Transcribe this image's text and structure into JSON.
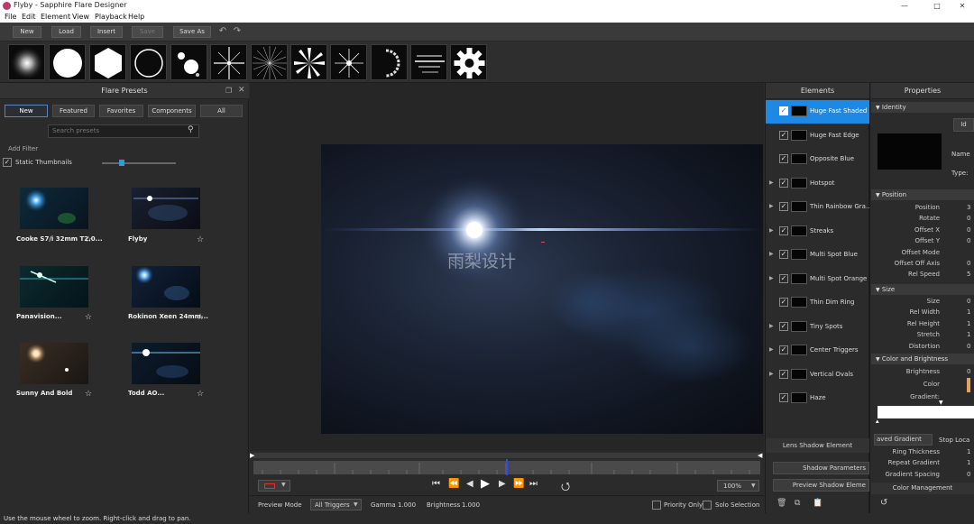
{
  "window": {
    "title": "Flyby - Sapphire Flare Designer"
  },
  "menu": [
    "File",
    "Edit",
    "Element",
    "View",
    "Playback",
    "Help"
  ],
  "toolbar": {
    "new": "New",
    "load": "Load",
    "insert": "Insert",
    "save": "Save",
    "save_as": "Save As"
  },
  "element_palette": [
    "glow",
    "circle",
    "hexagon",
    "ring",
    "spots",
    "star-4",
    "starburst",
    "rays",
    "sparkle",
    "arc",
    "streaks",
    "gear"
  ],
  "presets": {
    "title": "Flare Presets",
    "tabs": [
      "New",
      "Featured",
      "Favorites",
      "Components",
      "All"
    ],
    "search_placeholder": "Search presets",
    "add_filter": "Add Filter",
    "static_thumbnails": "Static Thumbnails",
    "items": [
      {
        "name": "Cooke S7/i 32mm T2.0..."
      },
      {
        "name": "Flyby"
      },
      {
        "name": "Panavision..."
      },
      {
        "name": "Rokinon Xeen 24mm..."
      },
      {
        "name": "Sunny And Bold"
      },
      {
        "name": "Todd AO..."
      }
    ]
  },
  "viewport": {
    "watermark": "雨梨设计",
    "zoom": "100%"
  },
  "preview": {
    "mode_label": "Preview Mode",
    "trigger": "All Triggers",
    "gamma_label": "Gamma",
    "gamma": "1.000",
    "brightness_label": "Brightness",
    "brightness": "1.000",
    "priority_only": "Priority Only",
    "solo_selection": "Solo Selection"
  },
  "elements": {
    "title": "Elements",
    "items": [
      {
        "name": "Huge Fast Shaded",
        "selected": true,
        "expand": false
      },
      {
        "name": "Huge Fast Edge",
        "selected": false,
        "expand": false
      },
      {
        "name": "Opposite Blue",
        "selected": false,
        "expand": false
      },
      {
        "name": "Hotspot",
        "selected": false,
        "expand": true
      },
      {
        "name": "Thin Rainbow Gra...",
        "selected": false,
        "expand": true
      },
      {
        "name": "Streaks",
        "selected": false,
        "expand": true
      },
      {
        "name": "Multi Spot Blue",
        "selected": false,
        "expand": true
      },
      {
        "name": "Multi Spot Orange",
        "selected": false,
        "expand": true
      },
      {
        "name": "Thin Dim Ring",
        "selected": false,
        "expand": false
      },
      {
        "name": "Tiny Spots",
        "selected": false,
        "expand": true
      },
      {
        "name": "Center Triggers",
        "selected": false,
        "expand": true
      },
      {
        "name": "Vertical Ovals",
        "selected": false,
        "expand": true
      },
      {
        "name": "Haze",
        "selected": false,
        "expand": false
      }
    ],
    "lens_shadow": "Lens Shadow Element",
    "shadow_params": "Shadow Parameters",
    "preview_shadow": "Preview Shadow Eleme"
  },
  "properties": {
    "title": "Properties",
    "identity": "Identity",
    "id_btn": "Id",
    "name_label": "Name",
    "type_label": "Type:",
    "position": "Position",
    "position_rows": [
      {
        "label": "Position",
        "val": "3"
      },
      {
        "label": "Rotate",
        "val": "0"
      },
      {
        "label": "Offset X",
        "val": "0"
      },
      {
        "label": "Offset Y",
        "val": "0"
      },
      {
        "label": "Offset Mode",
        "val": ""
      },
      {
        "label": "Offset Off Axis",
        "val": "0"
      },
      {
        "label": "Rel Speed",
        "val": "5"
      }
    ],
    "size": "Size",
    "size_rows": [
      {
        "label": "Size",
        "val": "0"
      },
      {
        "label": "Rel Width",
        "val": "1"
      },
      {
        "label": "Rel Height",
        "val": "1"
      },
      {
        "label": "Stretch",
        "val": "1"
      },
      {
        "label": "Distortion",
        "val": "0"
      }
    ],
    "color": "Color and Brightness",
    "color_rows": [
      {
        "label": "Brightness",
        "val": "0"
      },
      {
        "label": "Color",
        "val": ""
      },
      {
        "label": "Gradient:",
        "val": ""
      }
    ],
    "saved_gradient": "aved Gradient",
    "stop_loca": "Stop Loca",
    "ring_rows": [
      {
        "label": "Ring Thickness",
        "val": "1"
      },
      {
        "label": "Repeat Gradient",
        "val": "1"
      },
      {
        "label": "Gradient Spacing",
        "val": "0"
      }
    ],
    "color_mgmt": "Color Management"
  },
  "status": "Use the mouse wheel to zoom.  Right-click and drag to pan.",
  "colors": {
    "accent": "#1e88e5",
    "panel": "#2b2b2b"
  }
}
